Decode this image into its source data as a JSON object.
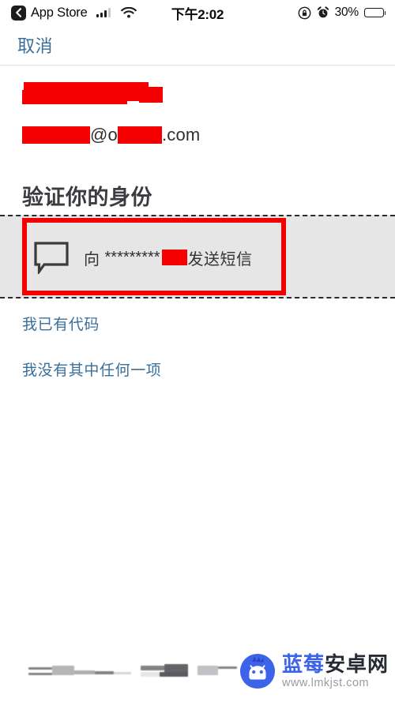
{
  "status_bar": {
    "back_label": "App Store",
    "back_icon": "chevron-left-icon",
    "signal_icon": "cellular-signal-icon",
    "wifi_icon": "wifi-icon",
    "time": "下午2:02",
    "rotation_lock_icon": "rotation-lock-icon",
    "alarm_icon": "alarm-clock-icon",
    "battery_percent": "30%",
    "battery_icon": "battery-icon",
    "battery_level": 30
  },
  "nav": {
    "cancel_label": "取消"
  },
  "account": {
    "name_redacted": "",
    "email_prefix_redacted": "",
    "email_at": "@o",
    "email_domain_redacted": "",
    "email_suffix": ".com"
  },
  "main": {
    "title": "验证你的身份",
    "option": {
      "icon": "speech-bubble-icon",
      "prefix": "向",
      "masked_phone": "*********",
      "phone_redacted": "",
      "action": "发送短信",
      "highlighted": true,
      "highlight_color": "#f40000",
      "band_color": "#e6e6e6"
    },
    "links": [
      {
        "label": "我已有代码"
      },
      {
        "label": "我没有其中任何一项"
      }
    ],
    "link_color": "#3a6f9b"
  },
  "footer": {
    "watermark_title_blue": "蓝莓",
    "watermark_title_dark": "安卓网",
    "watermark_url": "www.lmkjst.com",
    "watermark_logo_icon": "blueberry-android-mascot-icon",
    "brand_blue": "#3c63e8"
  }
}
